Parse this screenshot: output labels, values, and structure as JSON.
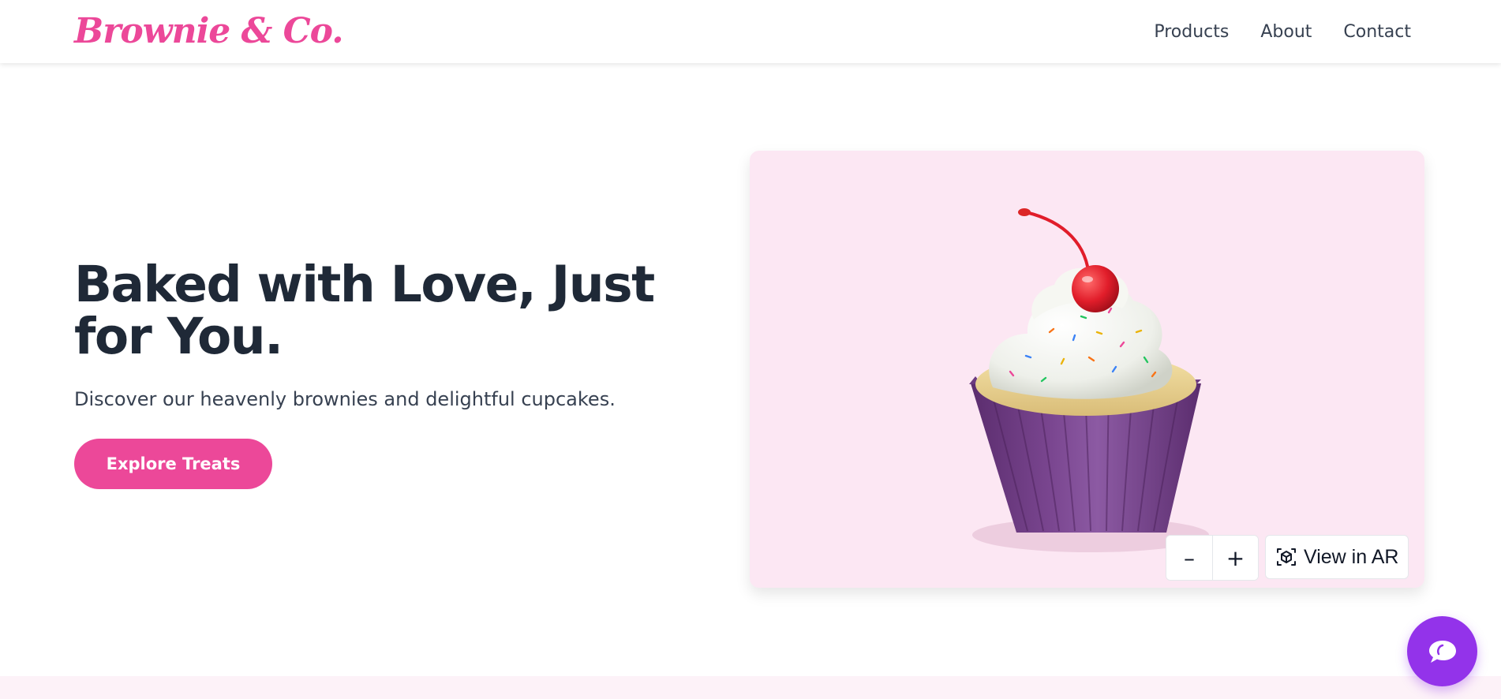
{
  "brand": {
    "name": "Brownie & Co.",
    "color": "#ec4899"
  },
  "nav": {
    "items": [
      {
        "label": "Products"
      },
      {
        "label": "About"
      },
      {
        "label": "Contact"
      }
    ]
  },
  "hero": {
    "title": "Baked with Love, Just for You.",
    "subtitle": "Discover our heavenly brownies and delightful cupcakes.",
    "cta_label": "Explore Treats"
  },
  "viewer": {
    "background": "#fce7f3",
    "model_icon": "cupcake-model",
    "zoom_out_label": "–",
    "zoom_in_label": "+",
    "ar_label": "View in AR",
    "ar_icon": "ar-cube-icon"
  },
  "chat": {
    "icon": "chat-bubble-icon",
    "color": "#9333ea"
  },
  "colors": {
    "primary": "#ec4899",
    "accent": "#9333ea",
    "text_dark": "#1f2937",
    "section_tint": "#fdf2f8"
  }
}
